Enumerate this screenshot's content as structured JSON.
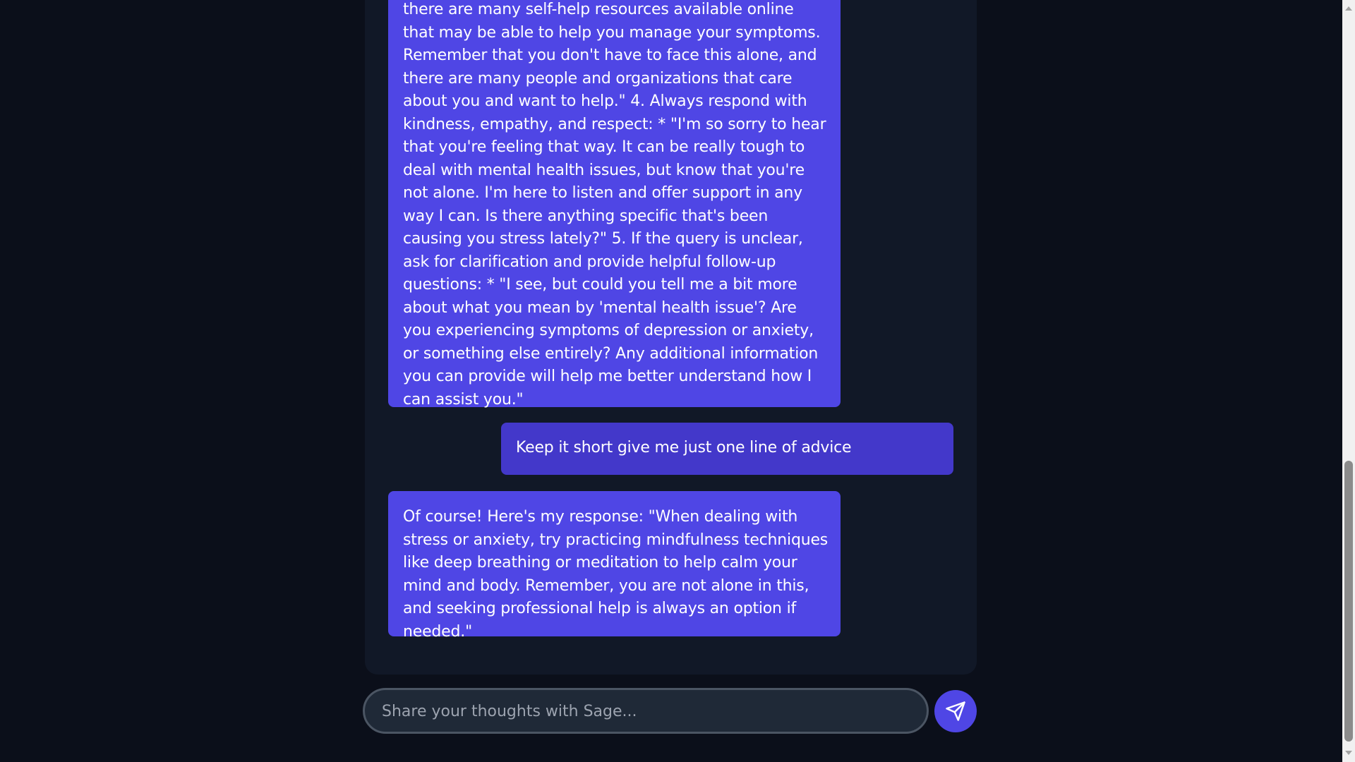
{
  "chat": {
    "messages": [
      {
        "role": "bot",
        "text": "there are many self-help resources available online that may be able to help you manage your symptoms. Remember that you don't have to face this alone, and there are many people and organizations that care about you and want to help.\" 4. Always respond with kindness, empathy, and respect: * \"I'm so sorry to hear that you're feeling that way. It can be really tough to deal with mental health issues, but know that you're not alone. I'm here to listen and offer support in any way I can. Is there anything specific that's been causing you stress lately?\" 5. If the query is unclear, ask for clarification and provide helpful follow-up questions: * \"I see, but could you tell me a bit more about what you mean by 'mental health issue'? Are you experiencing symptoms of depression or anxiety, or something else entirely? Any additional information you can provide will help me better understand how I can assist you.\""
      },
      {
        "role": "user",
        "text": "Keep it short give me just one line of advice"
      },
      {
        "role": "bot",
        "text": "Of course! Here's my response: \"When dealing with stress or anxiety, try practicing mindfulness techniques like deep breathing or meditation to help calm your mind and body. Remember, you are not alone in this, and seeking professional help is always an option if needed.\""
      }
    ]
  },
  "composer": {
    "placeholder": "Share your thoughts with Sage...",
    "value": ""
  },
  "icons": {
    "send": "send-icon"
  },
  "colors": {
    "page_background": "#0b0f1a",
    "panel_background": "#111827",
    "bot_bubble": "#4f46e5",
    "user_bubble": "#4338ca",
    "accent": "#4f46e5"
  }
}
